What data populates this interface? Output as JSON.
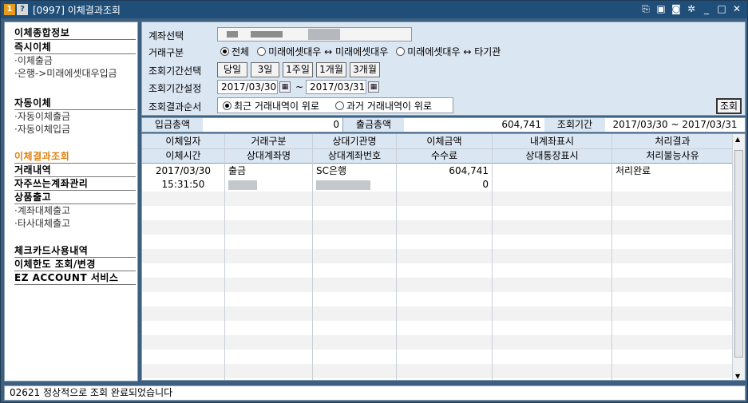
{
  "window": {
    "badge1": "1",
    "badge2": "?",
    "title": "[0997] 이체결과조회"
  },
  "sidebar": {
    "items": [
      {
        "label": "이체종합정보",
        "kind": "head"
      },
      {
        "label": "즉시이체",
        "kind": "head"
      },
      {
        "label": "·이체출금",
        "kind": "sub"
      },
      {
        "label": "·은행->미래에셋대우입금",
        "kind": "sub"
      },
      {
        "label": "자동이체",
        "kind": "head"
      },
      {
        "label": "·자동이체출금",
        "kind": "sub"
      },
      {
        "label": "·자동이체입금",
        "kind": "sub"
      },
      {
        "label": "이체결과조회",
        "kind": "head"
      },
      {
        "label": "거래내역",
        "kind": "head"
      },
      {
        "label": "자주쓰는계좌관리",
        "kind": "head"
      },
      {
        "label": "상품출고",
        "kind": "head"
      },
      {
        "label": "·계좌대체출고",
        "kind": "sub"
      },
      {
        "label": "·타사대체출고",
        "kind": "sub"
      },
      {
        "label": "체크카드사용내역",
        "kind": "head"
      },
      {
        "label": "이체한도 조회/변경",
        "kind": "head"
      },
      {
        "label": "EZ ACCOUNT 서비스",
        "kind": "head"
      }
    ]
  },
  "form": {
    "account_label": "계좌선택",
    "trade_type_label": "거래구분",
    "trade_types": [
      "전체",
      "미래에셋대우 ↔ 미래에셋대우",
      "미래에셋대우 ↔ 타기관"
    ],
    "period_select_label": "조회기간선택",
    "period_buttons": [
      "당일",
      "3일",
      "1주일",
      "1개월",
      "3개월"
    ],
    "period_set_label": "조회기간설정",
    "date_from": "2017/03/30",
    "date_sep": "~",
    "date_to": "2017/03/31",
    "order_label": "조회결과순서",
    "orders": [
      "최근 거래내역이 위로",
      "과거 거래내역이 위로"
    ],
    "search_button": "조회"
  },
  "summary": {
    "deposit_label": "입금총액",
    "deposit_value": "0",
    "withdraw_label": "출금총액",
    "withdraw_value": "604,741",
    "period_label": "조회기간",
    "period_value": "2017/03/30 ~ 2017/03/31"
  },
  "grid": {
    "header_row1": [
      "이체일자",
      "거래구분",
      "상대기관명",
      "이체금액",
      "내계좌표시",
      "처리결과"
    ],
    "header_row2": [
      "이체시간",
      "상대계좌명",
      "상대계좌번호",
      "수수료",
      "상대통장표시",
      "처리불능사유"
    ],
    "rows": [
      {
        "date": "2017/03/30",
        "type": "출금",
        "institution": "SC은행",
        "amount": "604,741",
        "my_memo": "",
        "result": "처리완료",
        "time": "15:31:50",
        "fee": "0"
      }
    ]
  },
  "status": {
    "message": "02621 정상적으로 조회 완료되었습니다"
  }
}
